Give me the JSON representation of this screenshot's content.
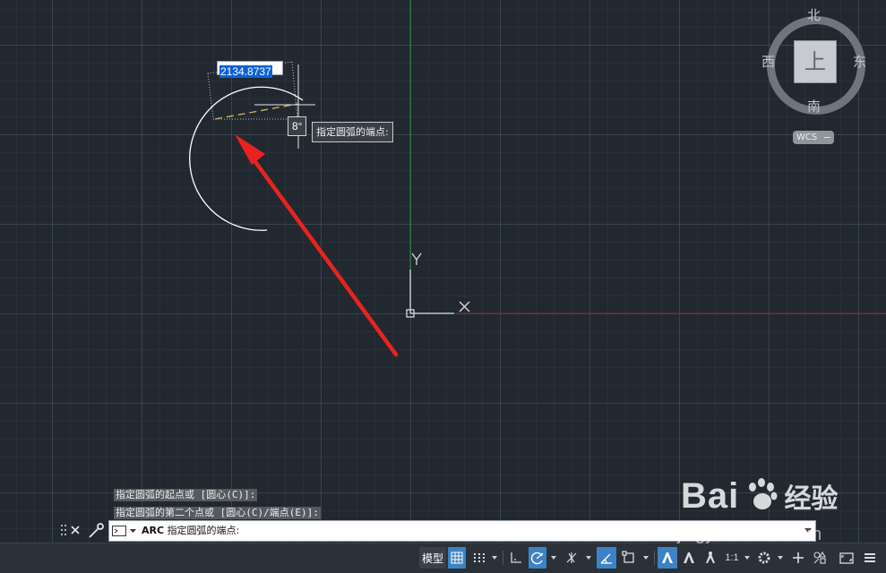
{
  "dimension": {
    "value": "2134.8737"
  },
  "angle": {
    "label": "8°"
  },
  "tooltip": {
    "text": "指定圆弧的端点:"
  },
  "ucs": {
    "y_label": "Y",
    "x_label": "X"
  },
  "viewcube": {
    "north": "北",
    "south": "南",
    "west": "西",
    "east": "东",
    "top_face": "上",
    "wcs_label": "WCS"
  },
  "command_history": [
    "指定圆弧的起点或 [圆心(C)]:",
    "指定圆弧的第二个点或 [圆心(C)/端点(E)]:"
  ],
  "command_line": {
    "command": "ARC",
    "prompt": "指定圆弧的端点:"
  },
  "status_bar": {
    "model_label": "模型",
    "scale_label": "1:1"
  },
  "watermark": {
    "brand": "Bai",
    "brand_suffix": "经验",
    "url": "jingyan.baidu.com"
  },
  "colors": {
    "background": "#212830",
    "arc": "#ffffff",
    "arrow": "#e8231f",
    "x_axis": "#b23a3a",
    "y_axis": "#2c8a3a",
    "preview": "#d6b35a",
    "toggle_on": "#3c82c4"
  }
}
